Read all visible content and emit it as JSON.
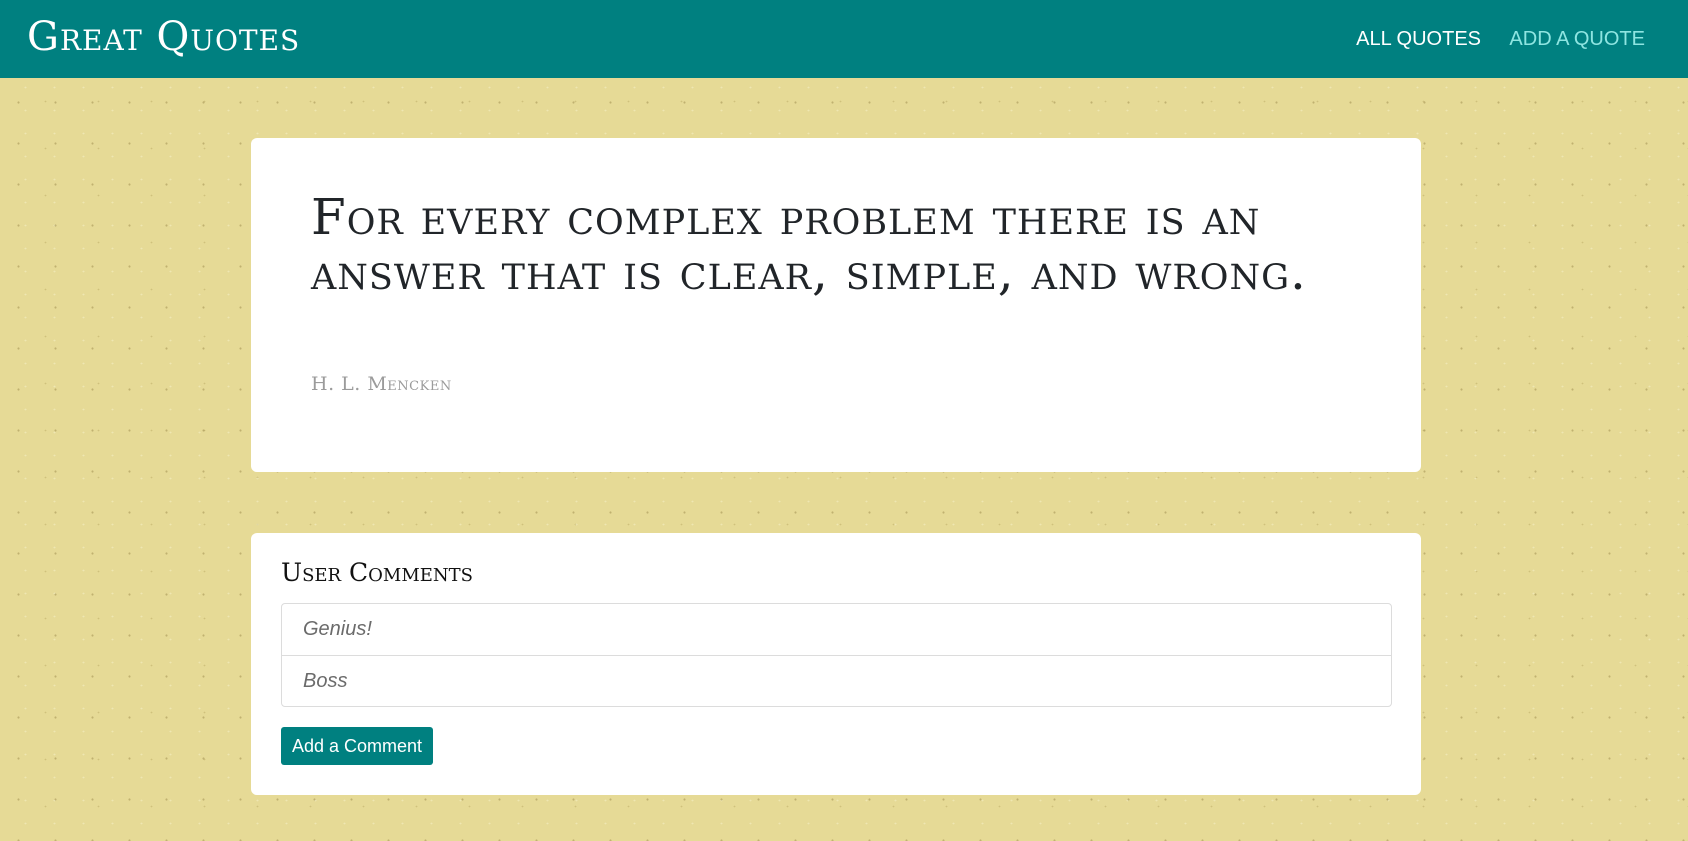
{
  "header": {
    "brand": "Great Quotes",
    "nav": {
      "all_quotes": "ALL QUOTES",
      "add_quote": "ADD A QUOTE"
    }
  },
  "quote": {
    "text": "For every complex problem there is an answer that is clear, simple, and wrong.",
    "author": "H. L. Mencken"
  },
  "comments": {
    "title": "User Comments",
    "items": [
      "Genius!",
      "Boss"
    ],
    "add_button_label": "Add a Comment"
  },
  "colors": {
    "navbar": "#008080",
    "background": "#e6da96",
    "active_link": "#8ee5e1",
    "button": "#008080"
  }
}
